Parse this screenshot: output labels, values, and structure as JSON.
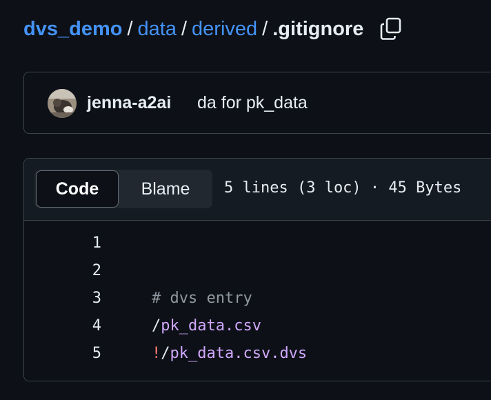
{
  "breadcrumb": {
    "root": "dvs_demo",
    "separator": "/",
    "folders": [
      "data",
      "derived"
    ],
    "file": ".gitignore",
    "copy_icon": "copy-icon"
  },
  "commit": {
    "avatar_icon": "user-avatar",
    "author": "jenna-a2ai",
    "message": "da for pk_data"
  },
  "file_view": {
    "tabs": [
      {
        "label": "Code",
        "selected": true
      },
      {
        "label": "Blame",
        "selected": false
      }
    ],
    "meta": "5 lines (3 loc) · 45 Bytes",
    "lines": [
      {
        "num": "1",
        "tokens": []
      },
      {
        "num": "2",
        "tokens": []
      },
      {
        "num": "3",
        "tokens": [
          {
            "type": "comment",
            "text": "# dvs entry"
          }
        ]
      },
      {
        "num": "4",
        "tokens": [
          {
            "type": "plain",
            "text": "/"
          },
          {
            "type": "path",
            "text": "pk_data.csv"
          }
        ]
      },
      {
        "num": "5",
        "tokens": [
          {
            "type": "neg",
            "text": "!"
          },
          {
            "type": "plain",
            "text": "/"
          },
          {
            "type": "path",
            "text": "pk_data.csv.dvs"
          }
        ]
      }
    ]
  },
  "colors": {
    "background": "#0d1117",
    "link": "#4493f8",
    "border": "#3d444d",
    "path_token": "#d2a8ff",
    "negation_token": "#ff7b72"
  }
}
